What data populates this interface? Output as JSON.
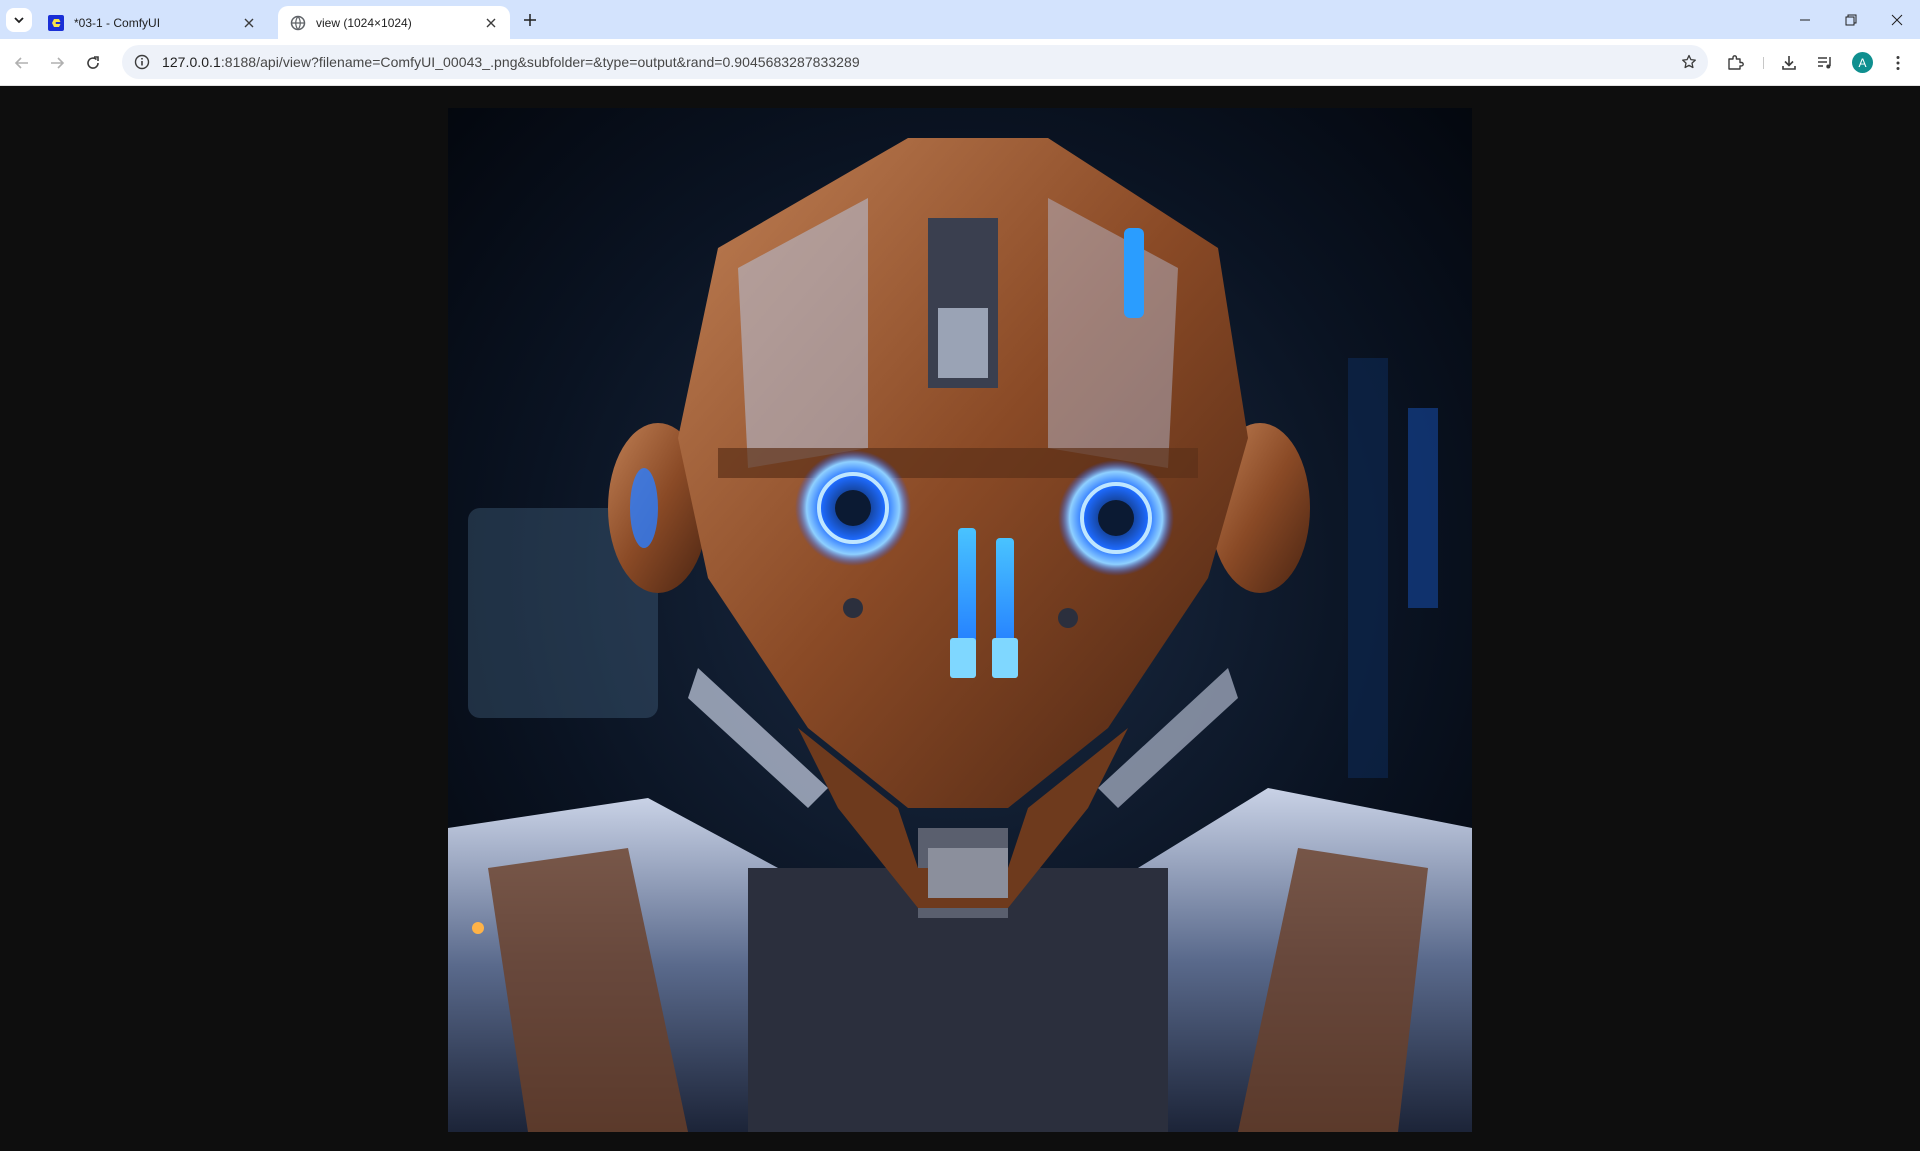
{
  "tabs": [
    {
      "title": "*03-1 - ComfyUI",
      "favicon": "comfyui-icon",
      "active": false
    },
    {
      "title": "view (1024×1024)",
      "favicon": "globe-icon",
      "active": true
    }
  ],
  "toolbar": {
    "url_host": "127.0.0.1",
    "url_rest": ":8188/api/view?filename=ComfyUI_00043_.png&subfolder=&type=output&rand=0.9045683287833289",
    "profile_initial": "A"
  },
  "viewer": {
    "background": "#0e0e0e",
    "image_subject": "rusted-robot-head-with-glowing-blue-eyes"
  },
  "colors": {
    "tabstrip": "#d3e3fd",
    "accent_glow": "#1e90ff",
    "rust": "#8a4a26"
  }
}
